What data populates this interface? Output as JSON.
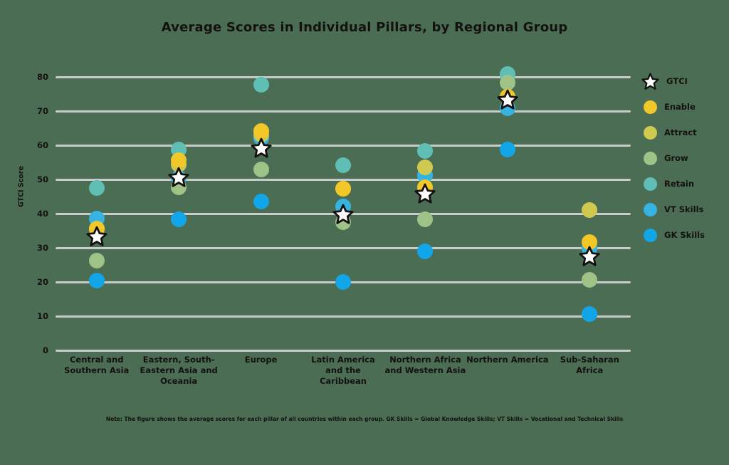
{
  "chart_data": {
    "type": "scatter",
    "title": "Average Scores in Individual Pillars, by Regional Group",
    "xlabel": "",
    "ylabel": "GTCI Score",
    "ylim": [
      0,
      80
    ],
    "yticks": [
      80,
      70,
      60,
      50,
      40,
      30,
      20,
      10,
      0
    ],
    "grid": true,
    "legend_position": "right",
    "note": "Note: The figure shows the average scores for each pillar of all countries within each group. GK Skills = Global Knowledge Skills; VT Skills = Vocational and Technical Skills",
    "categories": [
      "Central and Southern Asia",
      "Eastern, South-Eastern Asia and Oceania",
      "Europe",
      "Latin America and the Caribbean",
      "Northern Africa and Western Asia",
      "Northern America",
      "Sub-Saharan Africa"
    ],
    "series": [
      {
        "name": "GTCI",
        "marker": "star",
        "color": "#ffffff",
        "values": [
          33.3,
          50.6,
          59.2,
          39.8,
          45.8,
          73.3,
          27.5
        ]
      },
      {
        "name": "Enable",
        "marker": "circle",
        "color": "#f2c728",
        "values": [
          35.4,
          55.6,
          64.2,
          47.3,
          47.7,
          74.2,
          31.7
        ]
      },
      {
        "name": "Attract",
        "marker": "circle",
        "color": "#cfc94f",
        "values": [
          35.6,
          54.4,
          63.1,
          47.3,
          53.5,
          74.2,
          41.0
        ]
      },
      {
        "name": "Grow",
        "marker": "circle",
        "color": "#9fc287",
        "values": [
          26.3,
          47.7,
          52.9,
          37.5,
          38.3,
          78.3,
          20.6
        ]
      },
      {
        "name": "Retain",
        "marker": "circle",
        "color": "#5fbfb5",
        "values": [
          47.5,
          58.8,
          77.7,
          54.2,
          58.3,
          80.8,
          null
        ]
      },
      {
        "name": "VT Skills",
        "marker": "circle",
        "color": "#37b3e2",
        "values": [
          38.5,
          50.5,
          62.1,
          42.1,
          51.3,
          70.8,
          29.8
        ]
      },
      {
        "name": "GK Skills",
        "marker": "circle",
        "color": "#12a5e8",
        "values": [
          20.4,
          38.3,
          43.5,
          20.0,
          29.0,
          58.8,
          10.6
        ]
      }
    ]
  },
  "legend": {
    "items": [
      {
        "label": "GTCI",
        "icon": "star-icon",
        "color": "#ffffff"
      },
      {
        "label": "Enable",
        "icon": "circle-icon",
        "color": "#f2c728"
      },
      {
        "label": "Attract",
        "icon": "circle-icon",
        "color": "#cfc94f"
      },
      {
        "label": "Grow",
        "icon": "circle-icon",
        "color": "#9fc287"
      },
      {
        "label": "Retain",
        "icon": "circle-icon",
        "color": "#5fbfb5"
      },
      {
        "label": "VT Skills",
        "icon": "circle-icon",
        "color": "#37b3e2"
      },
      {
        "label": "GK Skills",
        "icon": "circle-icon",
        "color": "#12a5e8"
      }
    ]
  },
  "theme": {
    "background": "#4a6d54",
    "gridline": "#c9cbc8",
    "text": "#14110f"
  }
}
